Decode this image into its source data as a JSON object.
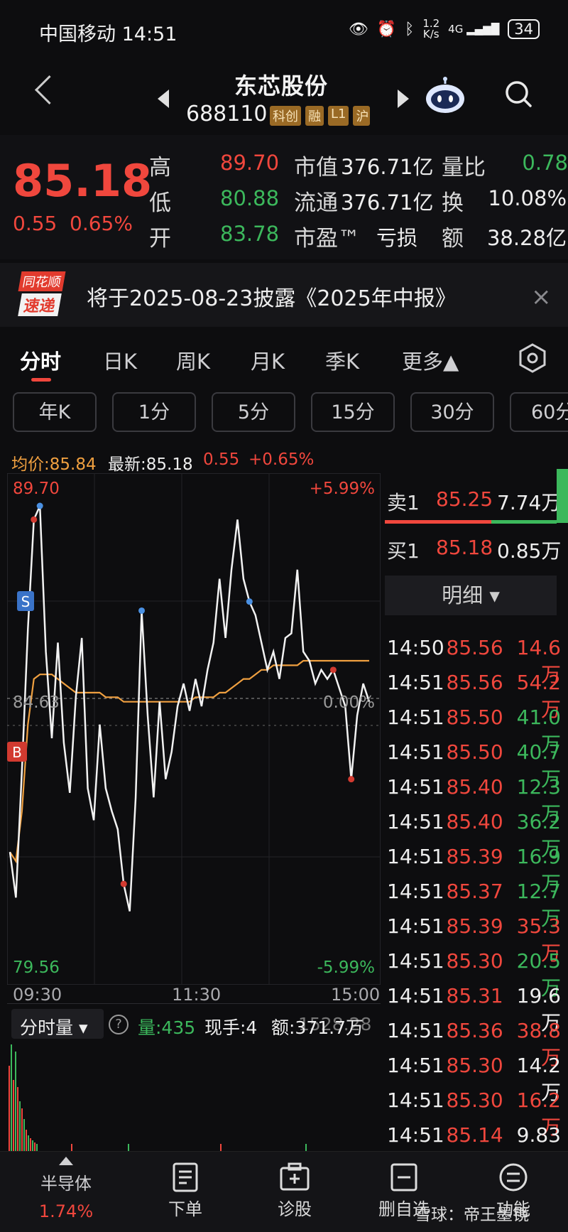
{
  "status": {
    "carrier_time": "中国移动 14:51",
    "net_speed_top": "1.2",
    "net_speed_unit": "K/s",
    "signal": "4G",
    "battery": "34"
  },
  "header": {
    "stock_name": "东芯股份",
    "stock_code": "688110",
    "tags": [
      "科创",
      "融",
      "L1",
      "沪"
    ]
  },
  "quote": {
    "price": "85.18",
    "change": "0.55",
    "change_pct": "0.65%",
    "rows": [
      {
        "l1": "高",
        "v1": "89.70",
        "l2": "市值",
        "v2": "376.71亿",
        "l3": "量比",
        "v3": "0.78"
      },
      {
        "l1": "低",
        "v1": "80.88",
        "l2": "流通",
        "v2": "376.71亿",
        "l3": "换",
        "v3": "10.08%"
      },
      {
        "l1": "开",
        "v1": "83.78",
        "l2": "市盈™",
        "v2": "亏损",
        "l3": "额",
        "v3": "38.28亿"
      }
    ]
  },
  "announcement": {
    "logo_top": "同花顺",
    "logo_bottom": "速递",
    "text": "将于2025-08-23披露《2025年中报》",
    "close": "×"
  },
  "tabs": [
    "分时",
    "日K",
    "周K",
    "月K",
    "季K",
    "更多▲"
  ],
  "periods": [
    "年K",
    "1分",
    "5分",
    "15分",
    "30分",
    "60分"
  ],
  "info": {
    "avg": "均价:85.84",
    "latest": "最新:85.18",
    "chg": "0.55",
    "pct": "+0.65%"
  },
  "chart_data": {
    "type": "line",
    "title": "",
    "x_ticks": [
      "09:30",
      "11:30",
      "15:00"
    ],
    "y_high": "89.70",
    "y_low": "79.56",
    "y_mid": "84.63",
    "pct_high": "+5.99%",
    "pct_low": "-5.99%",
    "pct_mid": "0.00%",
    "ylim": [
      79.56,
      89.7
    ],
    "prev_close": 84.63,
    "series": [
      {
        "values": [
          81.6,
          80.6,
          83.4,
          86.5,
          88.9,
          89.2,
          86.0,
          84.1,
          86.2,
          84.0,
          82.9,
          85.0,
          86.3,
          83.0,
          82.3,
          84.4,
          83.0,
          82.5,
          82.1,
          80.9,
          80.3,
          82.8,
          86.9,
          84.6,
          82.8,
          84.9,
          83.2,
          83.8,
          84.8,
          85.3,
          84.7,
          85.4,
          84.8,
          85.6,
          86.2,
          87.6,
          86.3,
          87.8,
          88.9,
          87.6,
          87.1,
          86.8,
          86.2,
          85.6,
          86.0,
          85.4,
          86.3,
          86.4,
          87.8,
          86.0,
          85.8,
          85.3,
          85.6,
          85.4,
          85.6,
          85.2,
          84.8,
          83.2,
          84.6,
          85.3,
          84.9
        ]
      },
      {
        "values": [
          81.6,
          81.4,
          82.5,
          84.4,
          85.4,
          85.5,
          85.5,
          85.5,
          85.4,
          85.3,
          85.2,
          85.1,
          85.1,
          85.1,
          85.1,
          85.1,
          85.0,
          85.0,
          85.0,
          84.9,
          84.9,
          84.9,
          84.9,
          84.9,
          84.9,
          84.9,
          84.9,
          84.9,
          84.9,
          84.9,
          84.9,
          85.0,
          85.0,
          85.0,
          85.0,
          85.1,
          85.1,
          85.2,
          85.3,
          85.4,
          85.4,
          85.5,
          85.6,
          85.6,
          85.7,
          85.7,
          85.7,
          85.7,
          85.7,
          85.8,
          85.8,
          85.8,
          85.8,
          85.8,
          85.8,
          85.8,
          85.8,
          85.8,
          85.8,
          85.8,
          85.8
        ]
      }
    ],
    "markers": {
      "S": "S",
      "B": "B"
    }
  },
  "orderbook": {
    "sell": {
      "label": "卖1",
      "price": "85.25",
      "vol": "7.74万"
    },
    "buy": {
      "label": "买1",
      "price": "85.18",
      "vol": "0.85万"
    },
    "detail": "明细 ▾",
    "ticks": [
      {
        "t": "14:50",
        "p": "85.56",
        "v": "14.6万",
        "c": "red"
      },
      {
        "t": "14:51",
        "p": "85.56",
        "v": "54.2万",
        "c": "red"
      },
      {
        "t": "14:51",
        "p": "85.50",
        "v": "41.0万",
        "c": "green"
      },
      {
        "t": "14:51",
        "p": "85.50",
        "v": "40.7万",
        "c": "green"
      },
      {
        "t": "14:51",
        "p": "85.40",
        "v": "12.3万",
        "c": "green"
      },
      {
        "t": "14:51",
        "p": "85.40",
        "v": "36.2万",
        "c": "green"
      },
      {
        "t": "14:51",
        "p": "85.39",
        "v": "16.9万",
        "c": "green"
      },
      {
        "t": "14:51",
        "p": "85.37",
        "v": "12.7万",
        "c": "green"
      },
      {
        "t": "14:51",
        "p": "85.39",
        "v": "35.3万",
        "c": "red"
      },
      {
        "t": "14:51",
        "p": "85.30",
        "v": "20.5万",
        "c": "green"
      },
      {
        "t": "14:51",
        "p": "85.31",
        "v": "19.6万",
        "c": "white"
      },
      {
        "t": "14:51",
        "p": "85.36",
        "v": "38.8万",
        "c": "red"
      },
      {
        "t": "14:51",
        "p": "85.30",
        "v": "14.2万",
        "c": "white"
      },
      {
        "t": "14:51",
        "p": "85.30",
        "v": "16.2万",
        "c": "red"
      },
      {
        "t": "14:51",
        "p": "85.14",
        "v": "9.83万",
        "c": "white"
      }
    ]
  },
  "volume": {
    "label": "分时量 ▾",
    "help": "?",
    "vol": "量:435",
    "hand": "现手:4",
    "amount": "额:371.7万",
    "overlay": "1528.28"
  },
  "bottom_nav": [
    {
      "label": "半导体",
      "sub": "1.74%"
    },
    {
      "label": "下单"
    },
    {
      "label": "诊股"
    },
    {
      "label": "删自选"
    },
    {
      "label": "功能"
    }
  ],
  "watermark": "雪球：帝王墨镜",
  "colors": {
    "up": "#f0473d",
    "down": "#3cb85c",
    "avg": "#f0a040"
  }
}
